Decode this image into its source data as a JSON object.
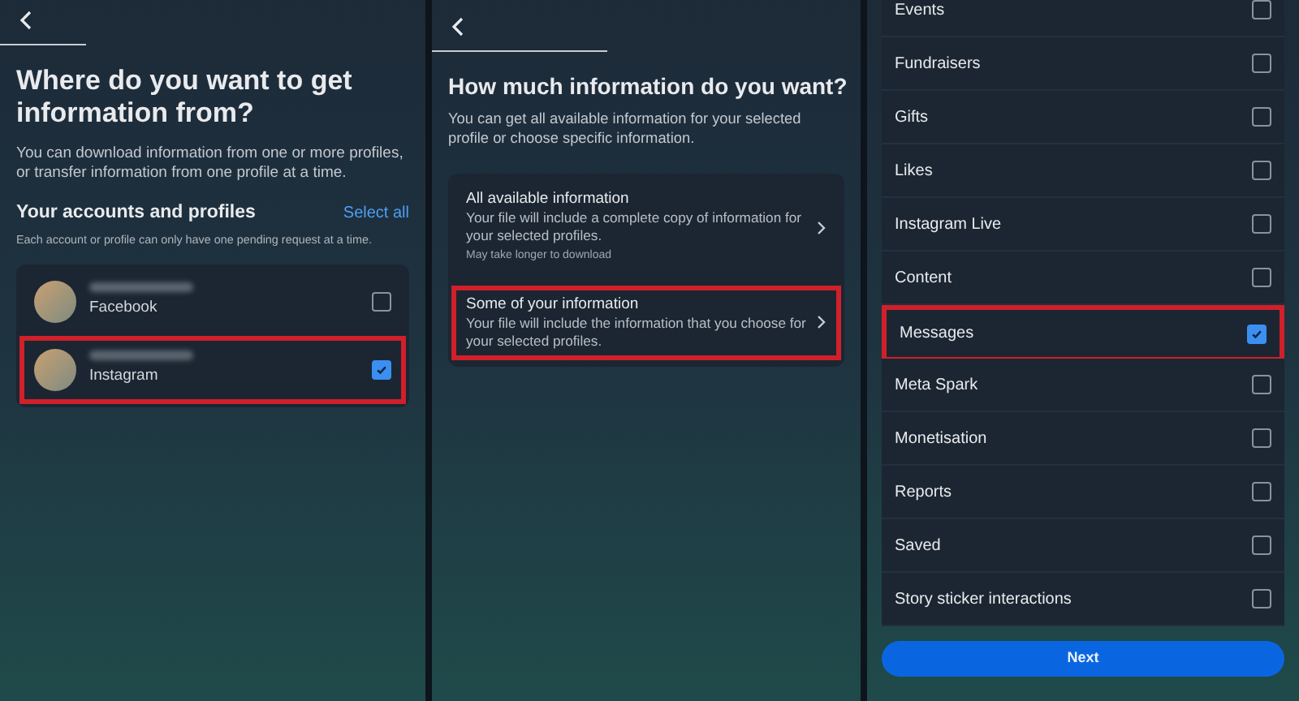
{
  "profile_screen": {
    "title": "Where do you want to get information from?",
    "description": "You can download information from one or more profiles, or transfer information from one profile at a time.",
    "section_title": "Your accounts and profiles",
    "select_all": "Select all",
    "note": "Each account or profile can only have one pending request at a time.",
    "accounts": [
      {
        "platform": "Facebook",
        "checked": false,
        "highlighted": false
      },
      {
        "platform": "Instagram",
        "checked": true,
        "highlighted": true
      }
    ]
  },
  "info_screen": {
    "title": "How much information do you want?",
    "description": "You can get all available information for your selected profile or choose specific information.",
    "options": [
      {
        "title": "All available information",
        "description": "Your file will include a complete copy of information for your selected profiles.",
        "note": "May take longer to download",
        "highlighted": false
      },
      {
        "title": "Some of your information",
        "description": "Your file will include the information that you choose for your selected profiles.",
        "highlighted": true
      }
    ]
  },
  "categories_screen": {
    "items": [
      {
        "label": "Events",
        "checked": false,
        "highlighted": false
      },
      {
        "label": "Fundraisers",
        "checked": false,
        "highlighted": false
      },
      {
        "label": "Gifts",
        "checked": false,
        "highlighted": false
      },
      {
        "label": "Likes",
        "checked": false,
        "highlighted": false
      },
      {
        "label": "Instagram Live",
        "checked": false,
        "highlighted": false
      },
      {
        "label": "Content",
        "checked": false,
        "highlighted": false
      },
      {
        "label": "Messages",
        "checked": true,
        "highlighted": true
      },
      {
        "label": "Meta Spark",
        "checked": false,
        "highlighted": false
      },
      {
        "label": "Monetisation",
        "checked": false,
        "highlighted": false
      },
      {
        "label": "Reports",
        "checked": false,
        "highlighted": false
      },
      {
        "label": "Saved",
        "checked": false,
        "highlighted": false
      },
      {
        "label": "Story sticker interactions",
        "checked": false,
        "highlighted": false
      }
    ],
    "next_button": "Next"
  }
}
